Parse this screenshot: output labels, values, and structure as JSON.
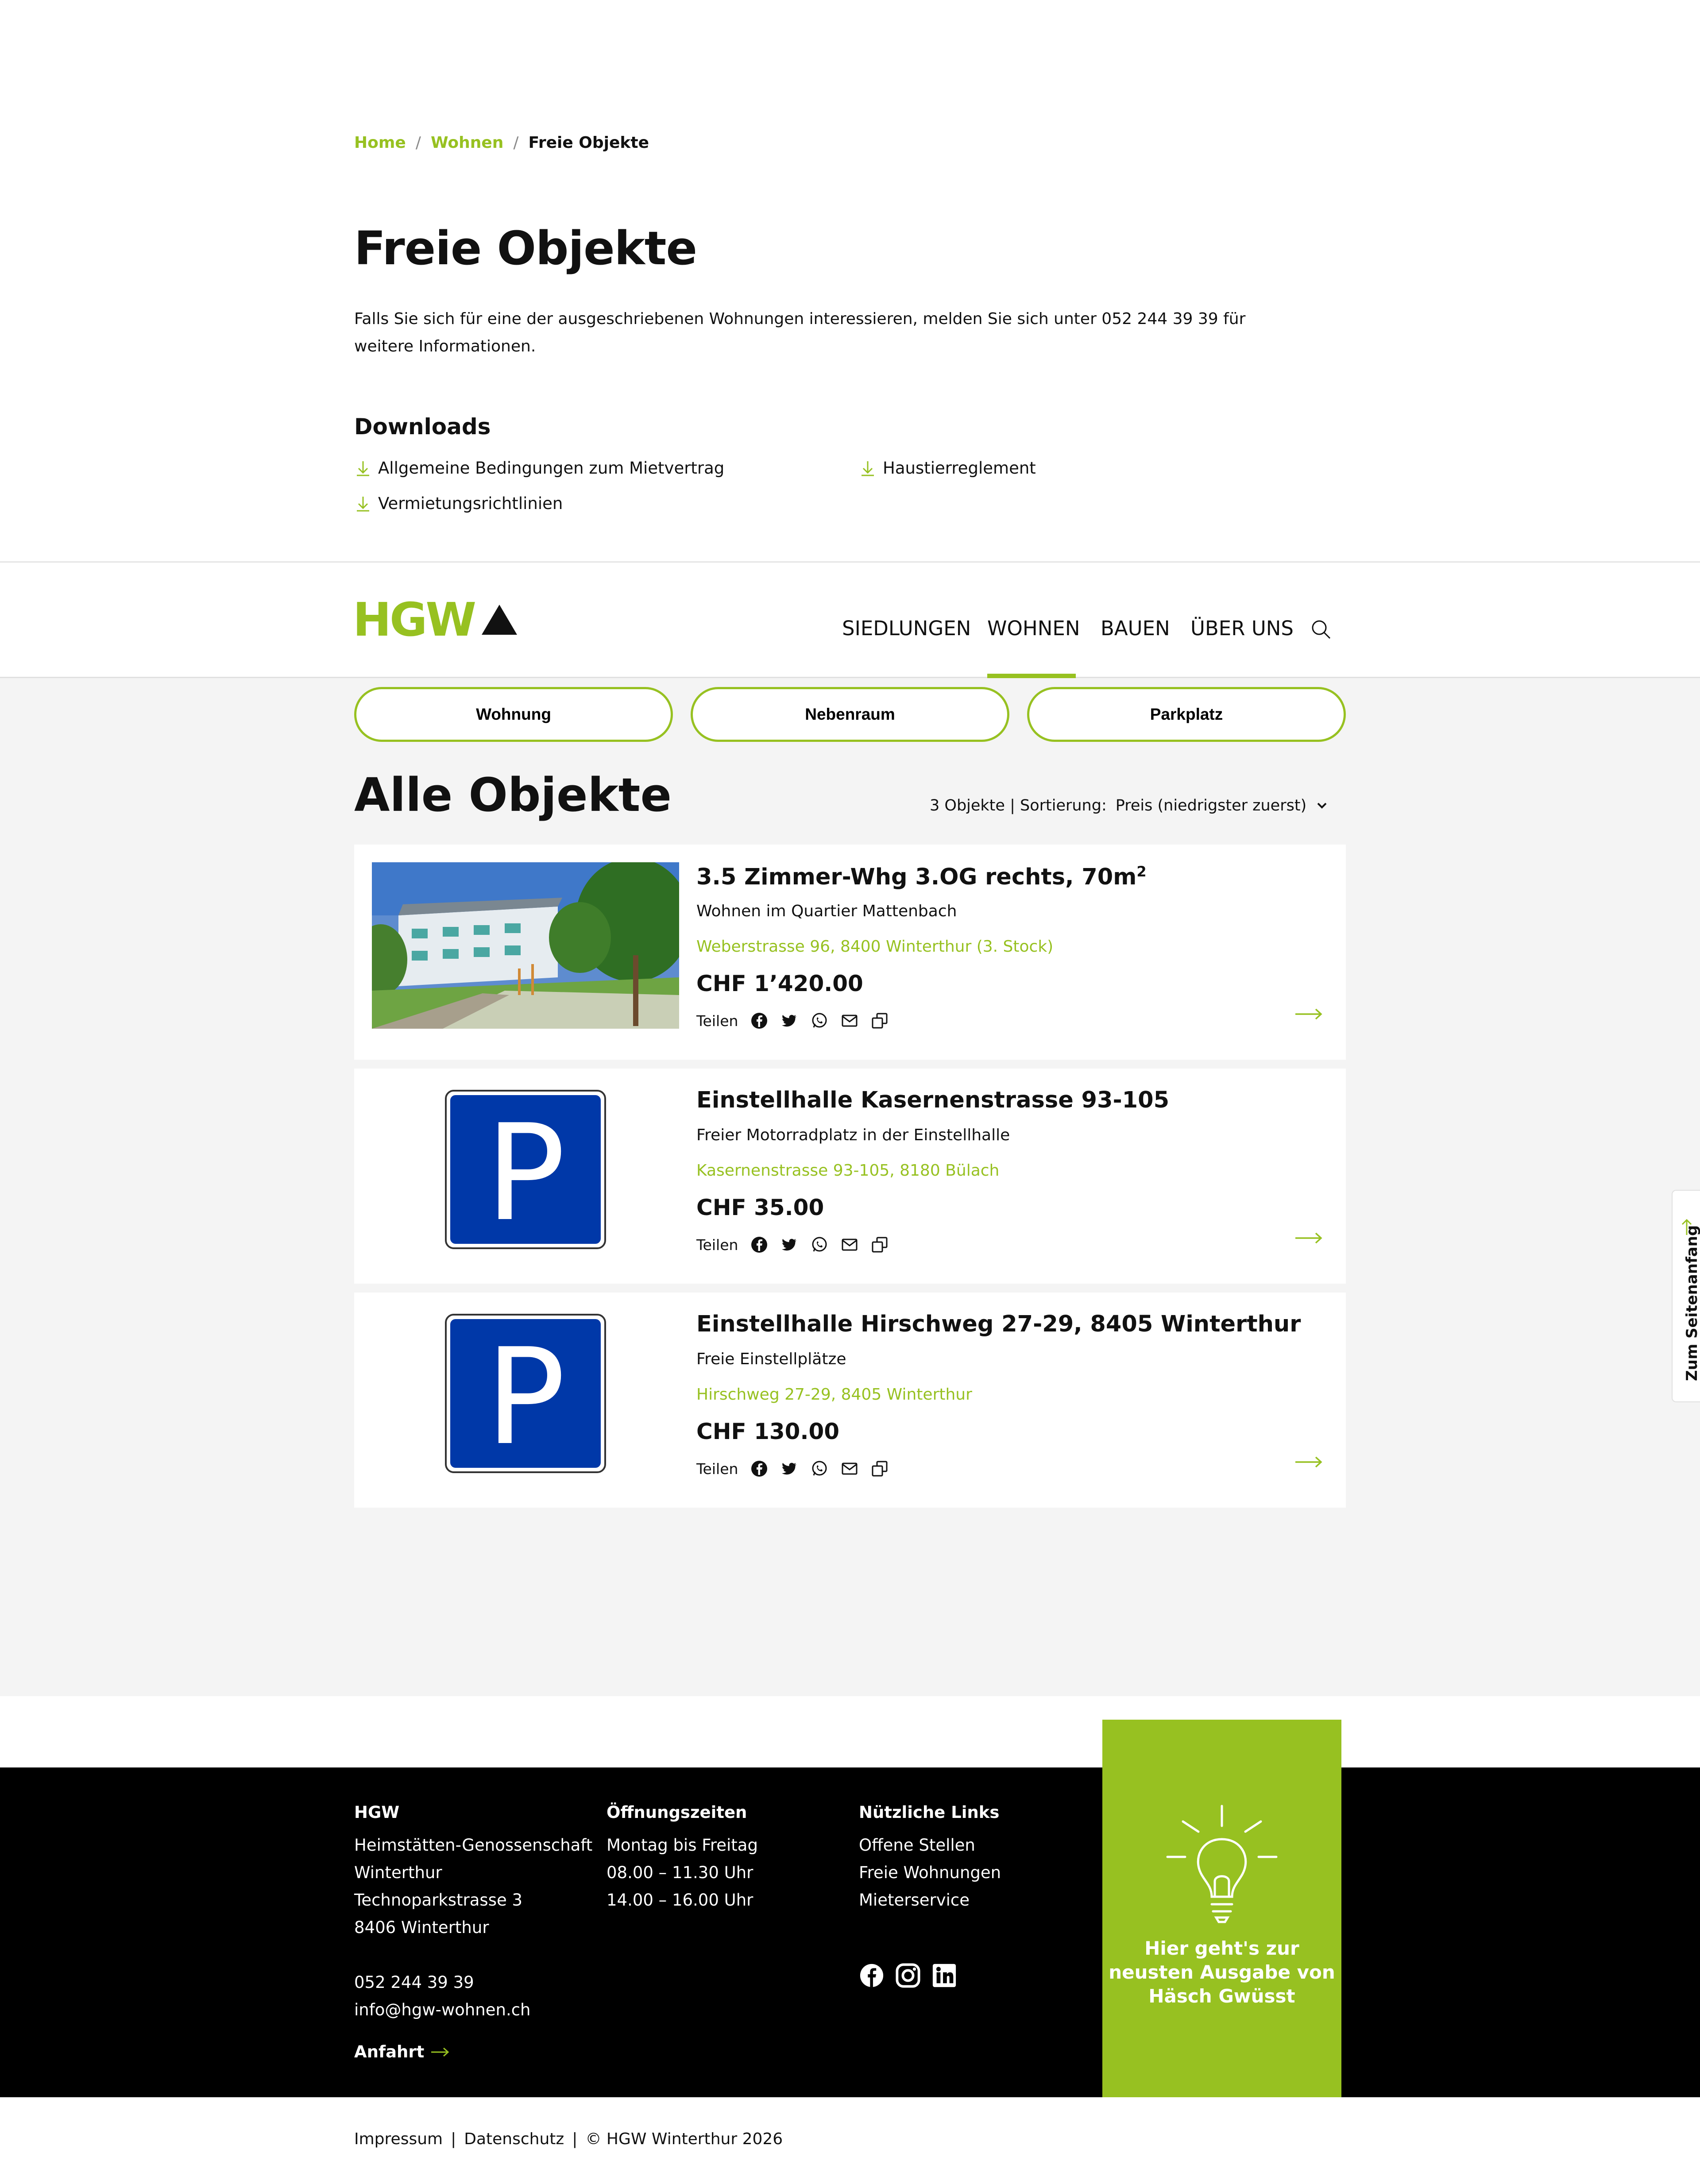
{
  "breadcrumb": {
    "home": "Home",
    "sep1": "/",
    "wohnen": "Wohnen",
    "sep2": "/",
    "current": "Freie Objekte"
  },
  "page": {
    "title": "Freie Objekte",
    "intro": "Falls Sie sich für eine der ausgeschriebenen Wohnungen interessieren, melden Sie sich unter 052 244 39 39 für weitere Informationen."
  },
  "downloads": {
    "heading": "Downloads",
    "items": [
      "Allgemeine Bedingungen zum Mietvertrag",
      "Haustierreglement",
      "Vermietungsrichtlinien"
    ]
  },
  "header": {
    "logo_text": "HGW",
    "nav": [
      "SIEDLUNGEN",
      "WOHNEN",
      "BAUEN",
      "ÜBER UNS"
    ],
    "active_nav": "WOHNEN"
  },
  "filters": [
    "Wohnung",
    "Nebenraum",
    "Parkplatz"
  ],
  "listing": {
    "title": "Alle Objekte",
    "count": "3 Objekte | Sortierung:",
    "sort_value": "Preis (niedrigster zuerst)"
  },
  "cards": [
    {
      "title": "3.5 Zimmer-Whg 3.OG rechts, 70m",
      "title_sup": "2",
      "subtitle": "Wohnen im Quartier Mattenbach",
      "address": "Weberstrasse 96, 8400 Winterthur (3. Stock)",
      "price": "CHF 1’420.00",
      "share_label": "Teilen",
      "image": "building-photo"
    },
    {
      "title": "Einstellhalle Kasernenstrasse 93-105",
      "subtitle": "Freier Motorradplatz in der Einstellhalle",
      "address": "Kasernenstrasse 93-105, 8180 Bülach",
      "price": "CHF 35.00",
      "share_label": "Teilen",
      "image": "parking-sign"
    },
    {
      "title": "Einstellhalle Hirschweg 27-29, 8405 Winterthur",
      "subtitle": "Freie Einstellplätze",
      "address": "Hirschweg 27-29, 8405 Winterthur",
      "price": "CHF 130.00",
      "share_label": "Teilen",
      "image": "parking-sign"
    }
  ],
  "side_tab": "Zum Seitenanfang",
  "footer": {
    "col1": {
      "heading": "HGW",
      "lines": [
        "Heimstätten-Genossenschaft",
        "Winterthur",
        "Technoparkstrasse 3",
        "8406 Winterthur"
      ],
      "phone": "052 244 39 39",
      "email": "info@hgw-wohnen.ch",
      "directions": "Anfahrt"
    },
    "col2": {
      "heading": "Öffnungszeiten",
      "lines": [
        "Montag bis Freitag",
        "08.00 – 11.30 Uhr",
        "14.00 – 16.00 Uhr"
      ]
    },
    "col3": {
      "heading": "Nützliche Links",
      "lines": [
        "Offene Stellen",
        "Freie Wohnungen",
        "Mieterservice"
      ]
    },
    "social_icons": [
      "facebook-icon",
      "instagram-icon",
      "linkedin-icon"
    ],
    "promo": "Hier geht's zur neusten Ausgabe von Häsch Gwüsst"
  },
  "bottom": {
    "impressum": "Impressum",
    "datenschutz": "Datenschutz",
    "copyright": "© HGW Winterthur 2026",
    "sep": "|"
  },
  "colors": {
    "accent": "#97c121",
    "background_grey": "#f4f4f4",
    "footer": "#000000",
    "parking_blue": "#0038a8"
  }
}
